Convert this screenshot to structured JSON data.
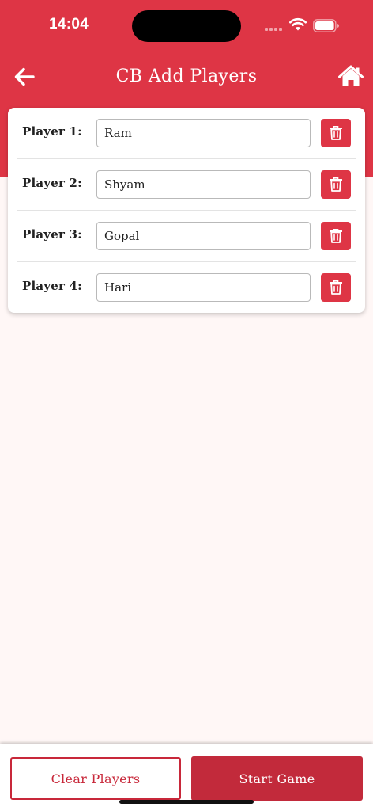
{
  "status_bar": {
    "time": "14:04"
  },
  "nav": {
    "title": "CB Add Players",
    "back_icon": "arrow-left-icon",
    "home_icon": "home-icon"
  },
  "players": [
    {
      "label": "Player 1:",
      "value": "Ram"
    },
    {
      "label": "Player 2:",
      "value": "Shyam"
    },
    {
      "label": "Player 3:",
      "value": "Gopal"
    },
    {
      "label": "Player 4:",
      "value": "Hari"
    }
  ],
  "actions": {
    "clear_label": "Clear Players",
    "start_label": "Start Game"
  },
  "colors": {
    "primary": "#de3545",
    "primary_dark": "#c22a3b",
    "background": "#fff7f6"
  }
}
